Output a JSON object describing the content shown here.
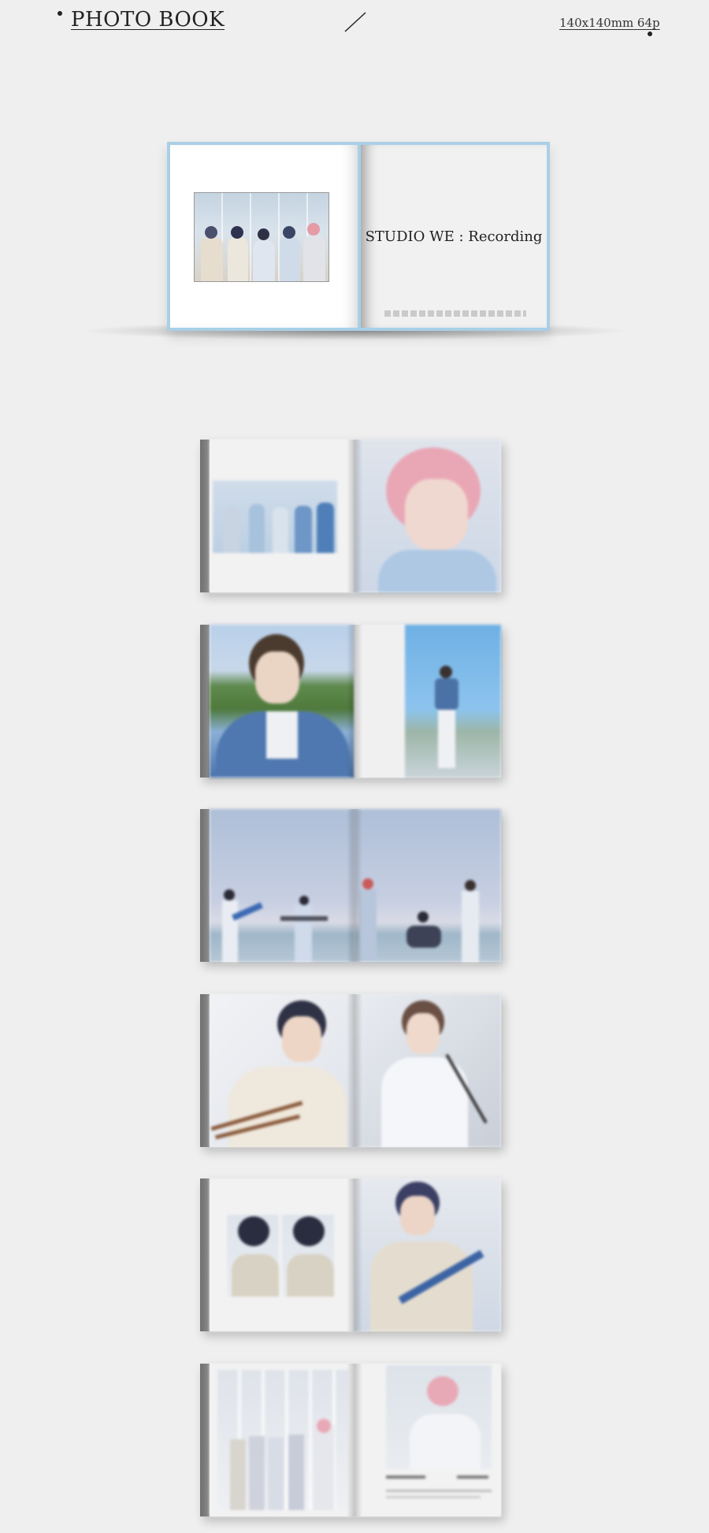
{
  "header": {
    "title": "PHOTO BOOK",
    "spec": "140x140mm 64p"
  },
  "cover": {
    "title": "STUDIO WE : Recording"
  },
  "colors": {
    "background": "#efefef",
    "cover_border": "#a9cfe6",
    "text": "#222222"
  },
  "icons": [
    "bullet-dot-icon",
    "slash-divider-icon"
  ],
  "spreads_count_label": ""
}
